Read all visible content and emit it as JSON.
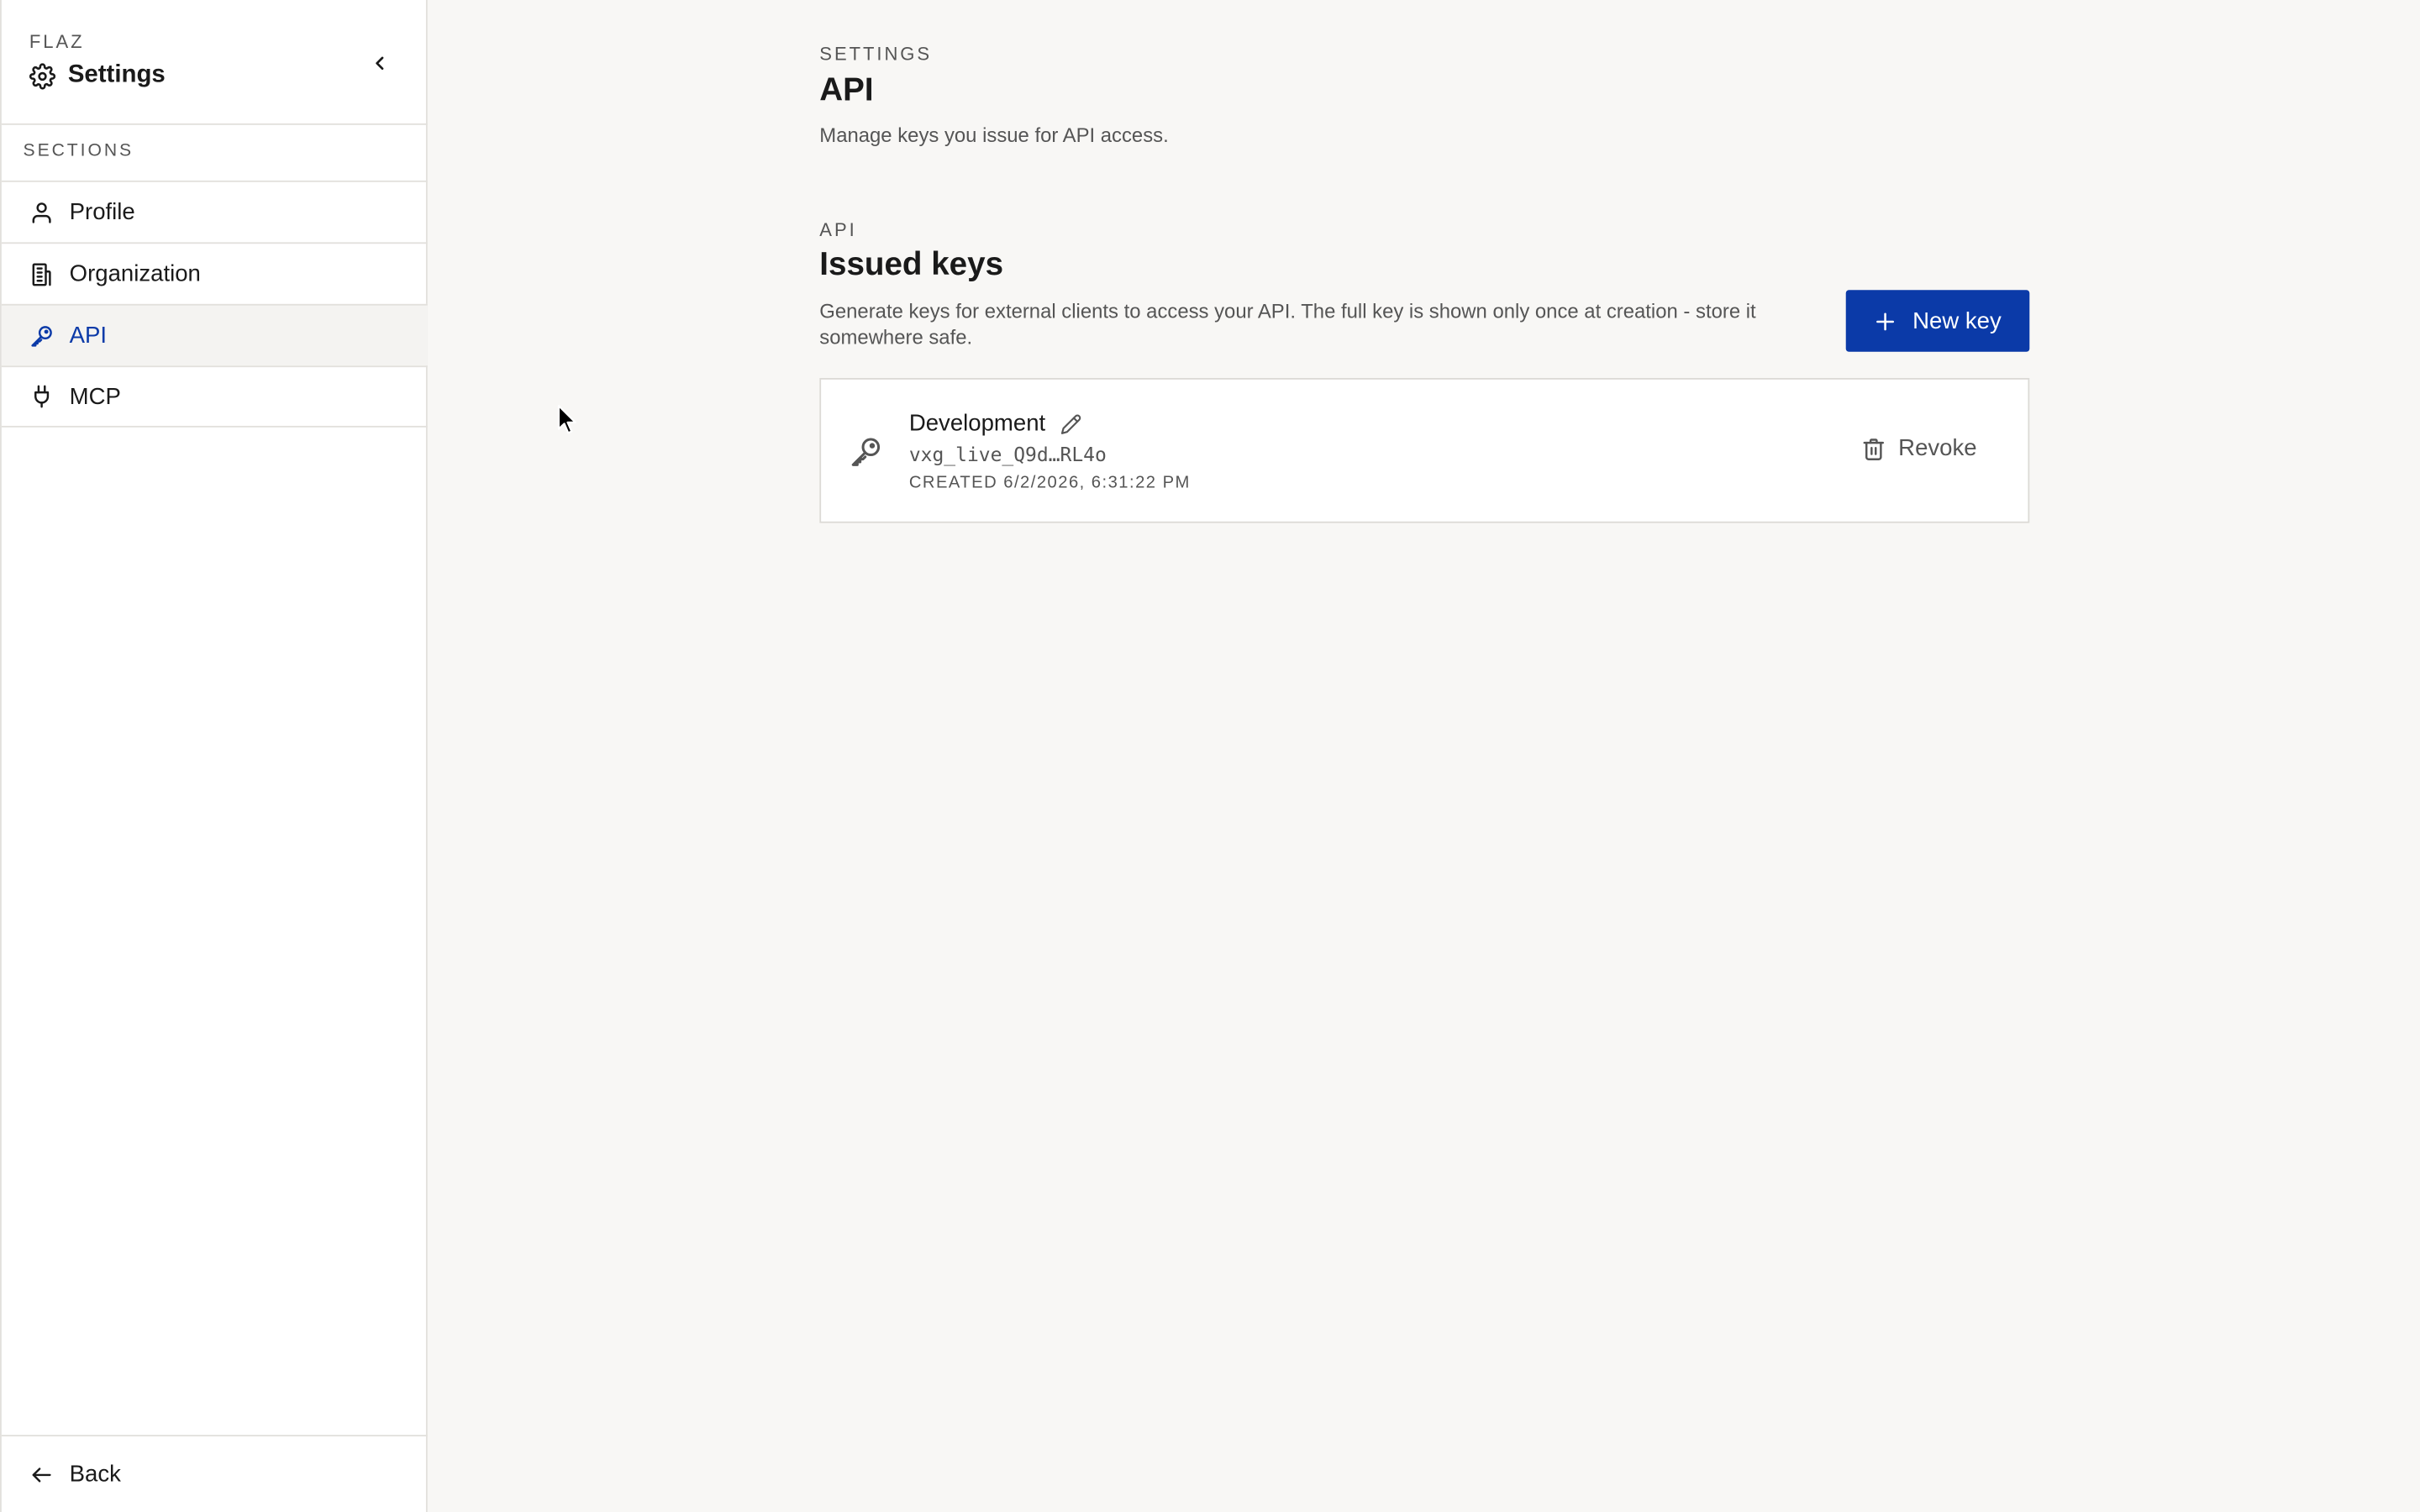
{
  "sidebar": {
    "brand": "FLAZ",
    "title": "Settings",
    "sections_label": "SECTIONS",
    "items": [
      {
        "label": "Profile",
        "icon": "user-icon"
      },
      {
        "label": "Organization",
        "icon": "building-icon"
      },
      {
        "label": "API",
        "icon": "key-icon",
        "active": true
      },
      {
        "label": "MCP",
        "icon": "plug-icon"
      }
    ],
    "back_label": "Back"
  },
  "page": {
    "eyebrow": "SETTINGS",
    "title": "API",
    "description": "Manage keys you issue for API access."
  },
  "section": {
    "eyebrow": "API",
    "title": "Issued keys",
    "description": "Generate keys for external clients to access your API. The full key is shown only once at creation - store it somewhere safe.",
    "new_key_label": "New key"
  },
  "keys": [
    {
      "name": "Development",
      "value": "vxg_live_Q9d…RL4o",
      "created": "CREATED 6/2/2026, 6:31:22 PM",
      "revoke_label": "Revoke"
    }
  ],
  "colors": {
    "accent": "#0b3aa8",
    "background": "#f8f7f5",
    "surface": "#ffffff",
    "border": "#e2e0dc"
  }
}
